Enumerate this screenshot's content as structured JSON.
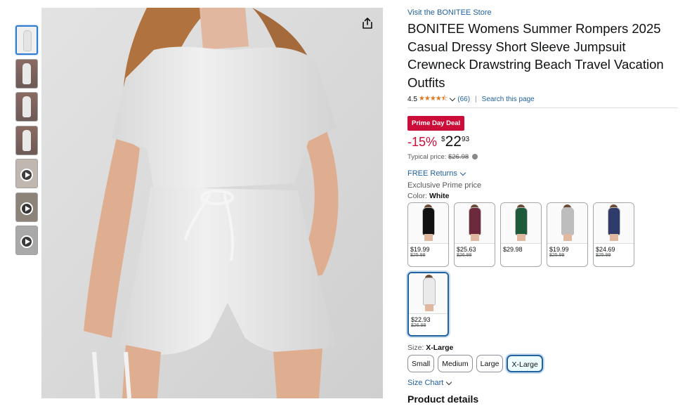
{
  "thumbnails": [
    {
      "kind": "image",
      "color": "#e6e6e6",
      "selected": true
    },
    {
      "kind": "image",
      "color": "#e6e6e6",
      "selected": false
    },
    {
      "kind": "image",
      "color": "#e6e6e6",
      "selected": false
    },
    {
      "kind": "image",
      "color": "#e6e6e6",
      "selected": false
    },
    {
      "kind": "video",
      "selected": false
    },
    {
      "kind": "video",
      "selected": false
    },
    {
      "kind": "video",
      "selected": false
    }
  ],
  "store": {
    "link_text": "Visit the BONITEE Store"
  },
  "product": {
    "title": "BONITEE Womens Summer Rompers 2025 Casual Dressy Short Sleeve Jumpsuit Crewneck Drawstring Beach Travel Vacation Outfits",
    "rating": "4.5",
    "stars": "★★★★⯪",
    "review_count": "(66)",
    "search_link": "Search this page"
  },
  "deal": {
    "badge": "Prime Day Deal",
    "discount": "-15%",
    "currency": "$",
    "price_whole": "22",
    "price_fraction": "93",
    "typical_label": "Typical price:",
    "typical_price": "$26.98"
  },
  "free_returns": "FREE Returns",
  "exclusive": "Exclusive Prime price",
  "color": {
    "label": "Color:",
    "selected": "White",
    "options": [
      {
        "color": "#111111",
        "price": "$19.99",
        "old": "$25.98",
        "selected": false
      },
      {
        "color": "#6e2a3d",
        "price": "$25.63",
        "old": "$26.98",
        "selected": false
      },
      {
        "color": "#1d5a3a",
        "price": "$29.98",
        "old": "",
        "selected": false
      },
      {
        "color": "#bdbdbd",
        "price": "$19.99",
        "old": "$25.99",
        "selected": false
      },
      {
        "color": "#2f3b6a",
        "price": "$24.69",
        "old": "$25.99",
        "selected": false
      },
      {
        "color": "#eaeaea",
        "price": "$22.93",
        "old": "$26.98",
        "selected": true
      }
    ]
  },
  "size": {
    "label": "Size:",
    "selected": "X-Large",
    "options": [
      "Small",
      "Medium",
      "Large",
      "X-Large"
    ]
  },
  "size_chart": "Size Chart",
  "product_details": "Product details"
}
